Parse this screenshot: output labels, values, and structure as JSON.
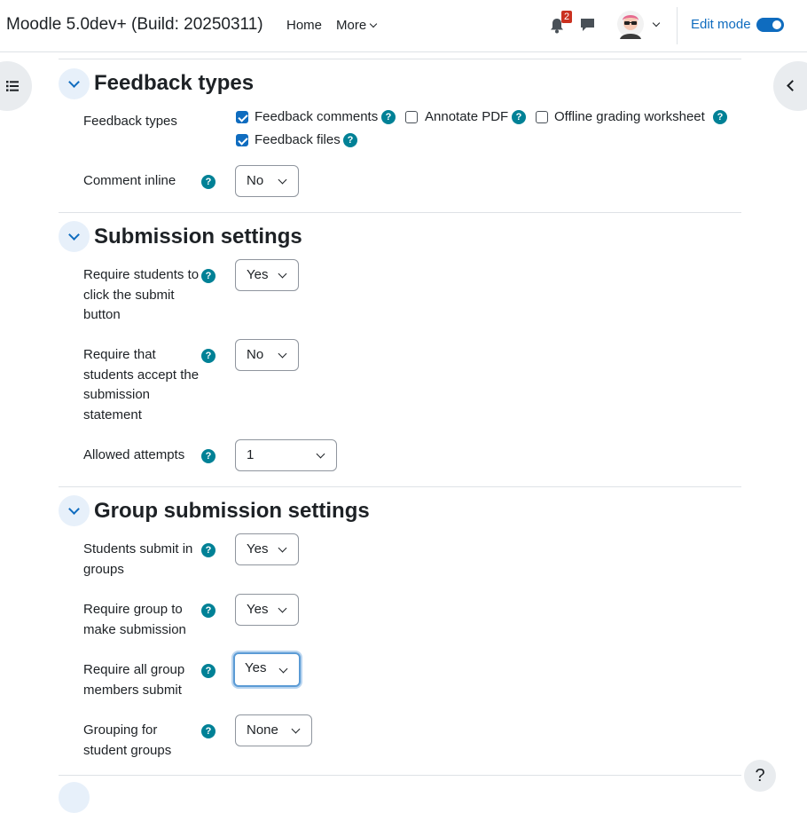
{
  "navbar": {
    "site_name": "Moodle 5.0dev+ (Build: 20250311)",
    "home": "Home",
    "more": "More",
    "notification_count": "2",
    "edit_mode_label": "Edit mode",
    "edit_mode_on": true
  },
  "help_glyph": "?",
  "sections": {
    "feedback": {
      "title": "Feedback types",
      "feedback_types_label": "Feedback types",
      "options": {
        "comments": {
          "label": "Feedback comments",
          "checked": true
        },
        "annotate_pdf": {
          "label": "Annotate PDF",
          "checked": false
        },
        "offline_worksheet": {
          "label": "Offline grading worksheet",
          "checked": false
        },
        "files": {
          "label": "Feedback files",
          "checked": true
        }
      },
      "comment_inline": {
        "label": "Comment inline",
        "value": "No"
      }
    },
    "submission": {
      "title": "Submission settings",
      "require_submit": {
        "label": "Require students to click the submit button",
        "value": "Yes"
      },
      "require_statement": {
        "label": "Require that students accept the submission statement",
        "value": "No"
      },
      "allowed_attempts": {
        "label": "Allowed attempts",
        "value": "1"
      }
    },
    "group": {
      "title": "Group submission settings",
      "submit_in_groups": {
        "label": "Students submit in groups",
        "value": "Yes"
      },
      "require_group": {
        "label": "Require group to make submission",
        "value": "Yes"
      },
      "require_all_members": {
        "label": "Require all group members submit",
        "value": "Yes"
      },
      "grouping": {
        "label": "Grouping for student groups",
        "value": "None"
      }
    }
  },
  "footer": {
    "help_button": "?"
  }
}
